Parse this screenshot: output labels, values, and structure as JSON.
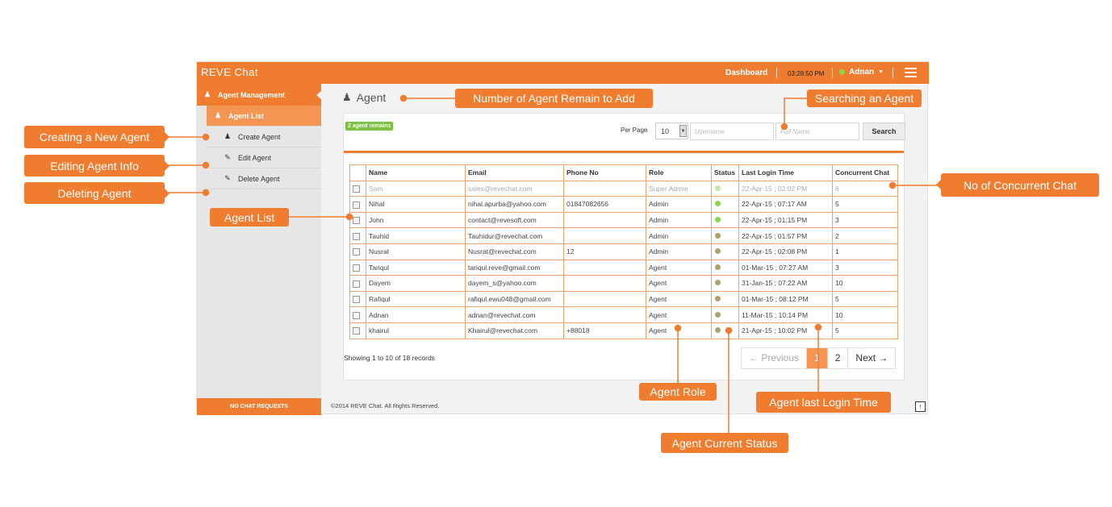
{
  "app": {
    "brand": "REVE Chat",
    "nav_dashboard": "Dashboard",
    "clock": "03:28:50 PM",
    "user_name": "Adnan",
    "accent": "#f07d2f"
  },
  "sidebar": {
    "header": "Agent Management",
    "items": [
      {
        "label": "Agent List",
        "icon": "users-icon"
      },
      {
        "label": "Create Agent",
        "icon": "user-icon"
      },
      {
        "label": "Edit Agent",
        "icon": "edit-icon"
      },
      {
        "label": "Delete Agent",
        "icon": "eraser-icon"
      }
    ],
    "footer": "NO CHAT REQUESTS"
  },
  "main": {
    "title": "Agent",
    "badge": "2 agent remains",
    "per_page_label": "Per Page",
    "per_page_value": "10",
    "username_placeholder": "Username",
    "fullname_placeholder": "Full Name",
    "search_button": "Search",
    "columns": [
      "Name",
      "Email",
      "Phone No",
      "Role",
      "Status",
      "Last Login Time",
      "Concurrent Chat"
    ],
    "rows": [
      {
        "name": "Sam",
        "email": "sales@revechat.com",
        "phone": "",
        "role": "Super Admin",
        "status": "online",
        "login": "22-Apr-15 ; 02:02 PM",
        "chat": "6",
        "muted": true
      },
      {
        "name": "Nihal",
        "email": "nihal.apurba@yahoo.com",
        "phone": "01847082656",
        "role": "Admin",
        "status": "online",
        "login": "22-Apr-15 ; 07:17 AM",
        "chat": "5"
      },
      {
        "name": "John",
        "email": "contact@revesoft.com",
        "phone": "",
        "role": "Admin",
        "status": "online",
        "login": "22-Apr-15 ; 01:15 PM",
        "chat": "3"
      },
      {
        "name": "Tauhid",
        "email": "Tauhidur@revechat.com",
        "phone": "",
        "role": "Admin",
        "status": "offline",
        "login": "22-Apr-15 ; 01:57 PM",
        "chat": "2"
      },
      {
        "name": "Nusrat",
        "email": "Nusrat@revechat.com",
        "phone": "12",
        "role": "Admin",
        "status": "offline",
        "login": "22-Apr-15 ; 02:08 PM",
        "chat": "1"
      },
      {
        "name": "Tariqul",
        "email": "tariqul.reve@gmail.com",
        "phone": "",
        "role": "Agent",
        "status": "offline",
        "login": "01-Mar-15 ; 07:27 AM",
        "chat": "3"
      },
      {
        "name": "Dayem",
        "email": "dayem_s@yahoo.com",
        "phone": "",
        "role": "Agent",
        "status": "offline",
        "login": "31-Jan-15 ; 07:22 AM",
        "chat": "10"
      },
      {
        "name": "Rafiqul",
        "email": "rafiqul.ewu048@gmail.com",
        "phone": "",
        "role": "Agent",
        "status": "offline",
        "login": "01-Mar-15 ; 08:12 PM",
        "chat": "5"
      },
      {
        "name": "Adnan",
        "email": "adnan@revechat.com",
        "phone": "",
        "role": "Agent",
        "status": "offline",
        "login": "11-Mar-15 ; 10:14 PM",
        "chat": "10"
      },
      {
        "name": "khairul",
        "email": "Khairul@revechat.com",
        "phone": "+88018",
        "role": "Agent",
        "status": "offline",
        "login": "21-Apr-15 ; 10:02 PM",
        "chat": "5"
      }
    ],
    "status_colors": {
      "online": "#8bd64a",
      "offline": "#b0a070"
    },
    "records_text": "Showing 1 to 10 of 18 records",
    "pager": {
      "prev": "← Previous",
      "pages": [
        "1",
        "2"
      ],
      "current": "1",
      "next": "Next →"
    }
  },
  "footer": {
    "copyright": "©2014 REVE Chat. All Rights Reserved."
  },
  "callouts": {
    "creating": "Creating a New Agent",
    "editing": "Editing Agent Info",
    "deleting": "Deleting Agent",
    "agent_list": "Agent List",
    "remain": "Number of Agent Remain to Add",
    "searching": "Searching an Agent",
    "concurrent": "No of Concurrent Chat",
    "role": "Agent Role",
    "login": "Agent last Login Time",
    "status": "Agent Current Status"
  }
}
